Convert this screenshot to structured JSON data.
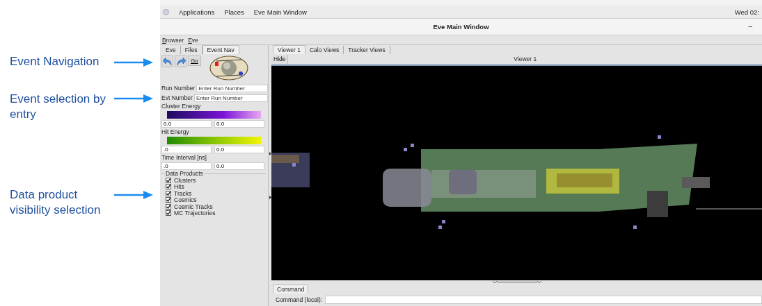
{
  "annotations": [
    {
      "text": "Event Navigation"
    },
    {
      "text": "Event selection by entry"
    },
    {
      "text": "Data product visibility selection"
    }
  ],
  "top_bar": {
    "menus": [
      "Applications",
      "Places",
      "Eve Main Window"
    ],
    "clock": "Wed 02:"
  },
  "window": {
    "title": "Eve Main Window",
    "minimize": "–"
  },
  "menu_bar": [
    "Browser",
    "Eve"
  ],
  "left_tabs": [
    {
      "label": "Eve",
      "selected": false
    },
    {
      "label": "Files",
      "selected": false
    },
    {
      "label": "Event Nav",
      "selected": true
    }
  ],
  "nav": {
    "go": "Go"
  },
  "entry_fields": [
    {
      "label": "Run Number",
      "placeholder": "Enter Run Number"
    },
    {
      "label": "Evt Number",
      "placeholder": "Enter Run Number"
    }
  ],
  "ranges": [
    {
      "label": "Cluster Energy",
      "kind": "cluster",
      "min": "0.0",
      "max": "0.0"
    },
    {
      "label": "Hit Energy",
      "kind": "hit",
      "min": ".0",
      "max": "0.0"
    },
    {
      "label": "Time Interval [ns]",
      "kind": "plain",
      "min": ".0",
      "max": "0.0"
    }
  ],
  "data_products": {
    "title": "Data Products",
    "items": [
      {
        "label": "Clusters",
        "checked": true
      },
      {
        "label": "Hits",
        "checked": true
      },
      {
        "label": "Tracks",
        "checked": true
      },
      {
        "label": "Cosmics",
        "checked": true
      },
      {
        "label": "Cosmic Tracks",
        "checked": true
      },
      {
        "label": "MC Trajectories",
        "checked": true
      }
    ]
  },
  "viewer_tabs": [
    {
      "label": "Viewer 1",
      "selected": true
    },
    {
      "label": "Calo Views",
      "selected": false
    },
    {
      "label": "Tracker Views",
      "selected": false
    }
  ],
  "viewer": {
    "hide": "Hide",
    "title": "Viewer 1"
  },
  "command": {
    "tab": "Command",
    "label": "Command (local):"
  }
}
